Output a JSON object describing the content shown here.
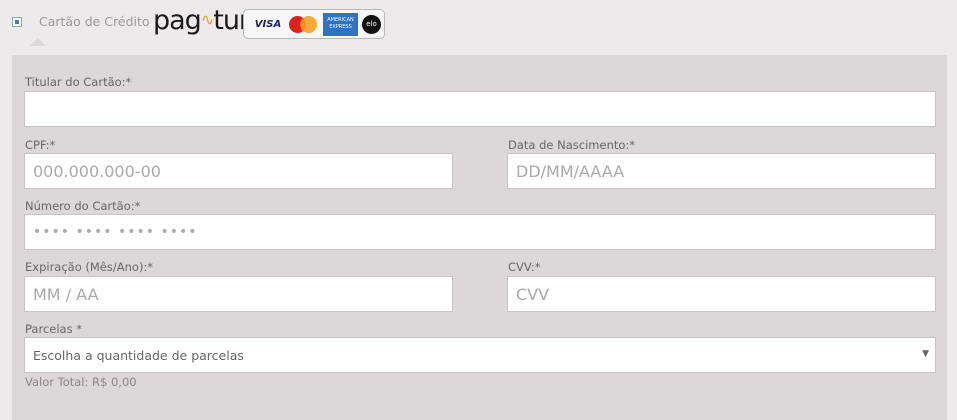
{
  "payment_method": {
    "label": "Cartão de Crédito",
    "provider_logo": "pag tur",
    "brands": [
      "VISA",
      "MasterCard",
      "AMERICAN EXPRESS",
      "elo"
    ]
  },
  "form": {
    "cardholder": {
      "label": "Titular do Cartão:*",
      "placeholder": ""
    },
    "cpf": {
      "label": "CPF:*",
      "placeholder": "000.000.000-00"
    },
    "birth_date": {
      "label": "Data de Nascimento:*",
      "placeholder": "DD/MM/AAAA"
    },
    "card_number": {
      "label": "Número do Cartão:*",
      "placeholder": "•••• •••• •••• ••••"
    },
    "expiry": {
      "label": "Expiração (Mês/Ano):*",
      "placeholder": "MM / AA"
    },
    "cvv": {
      "label": "CVV:*",
      "placeholder": "CVV"
    },
    "installments": {
      "label": "Parcelas *",
      "selected": "Escolha a quantidade de parcelas"
    },
    "total": "Valor Total: R$ 0,00"
  },
  "colors": {
    "background": "#edeaec",
    "panel": "#dcd8da",
    "radio": "#4a7bb0"
  }
}
